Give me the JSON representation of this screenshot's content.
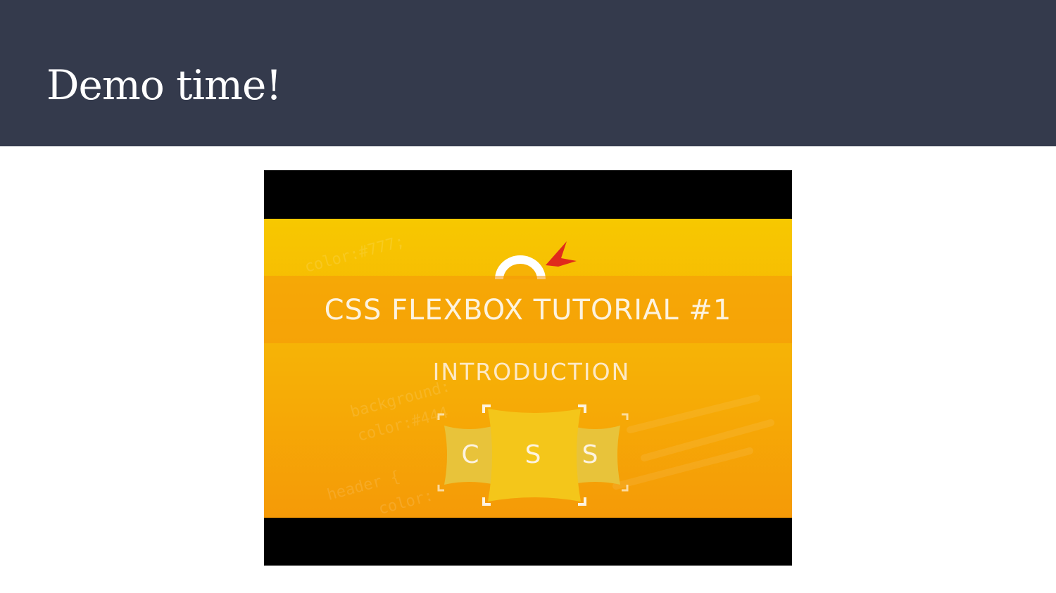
{
  "slide": {
    "title": "Demo time!"
  },
  "video_thumbnail": {
    "title": "CSS FLEXBOX TUTORIAL #1",
    "subtitle": "INTRODUCTION",
    "logo_letters": [
      "C",
      "S",
      "S"
    ],
    "background_code": [
      "color:#777;",
      "background:",
      "color:#444",
      "header {",
      "color:"
    ]
  },
  "colors": {
    "header_bg": "#343a4c",
    "title_text": "#ffffff",
    "thumbnail_yellow": "#f7c800",
    "thumbnail_orange": "#f59a07",
    "letterbox": "#000000"
  }
}
